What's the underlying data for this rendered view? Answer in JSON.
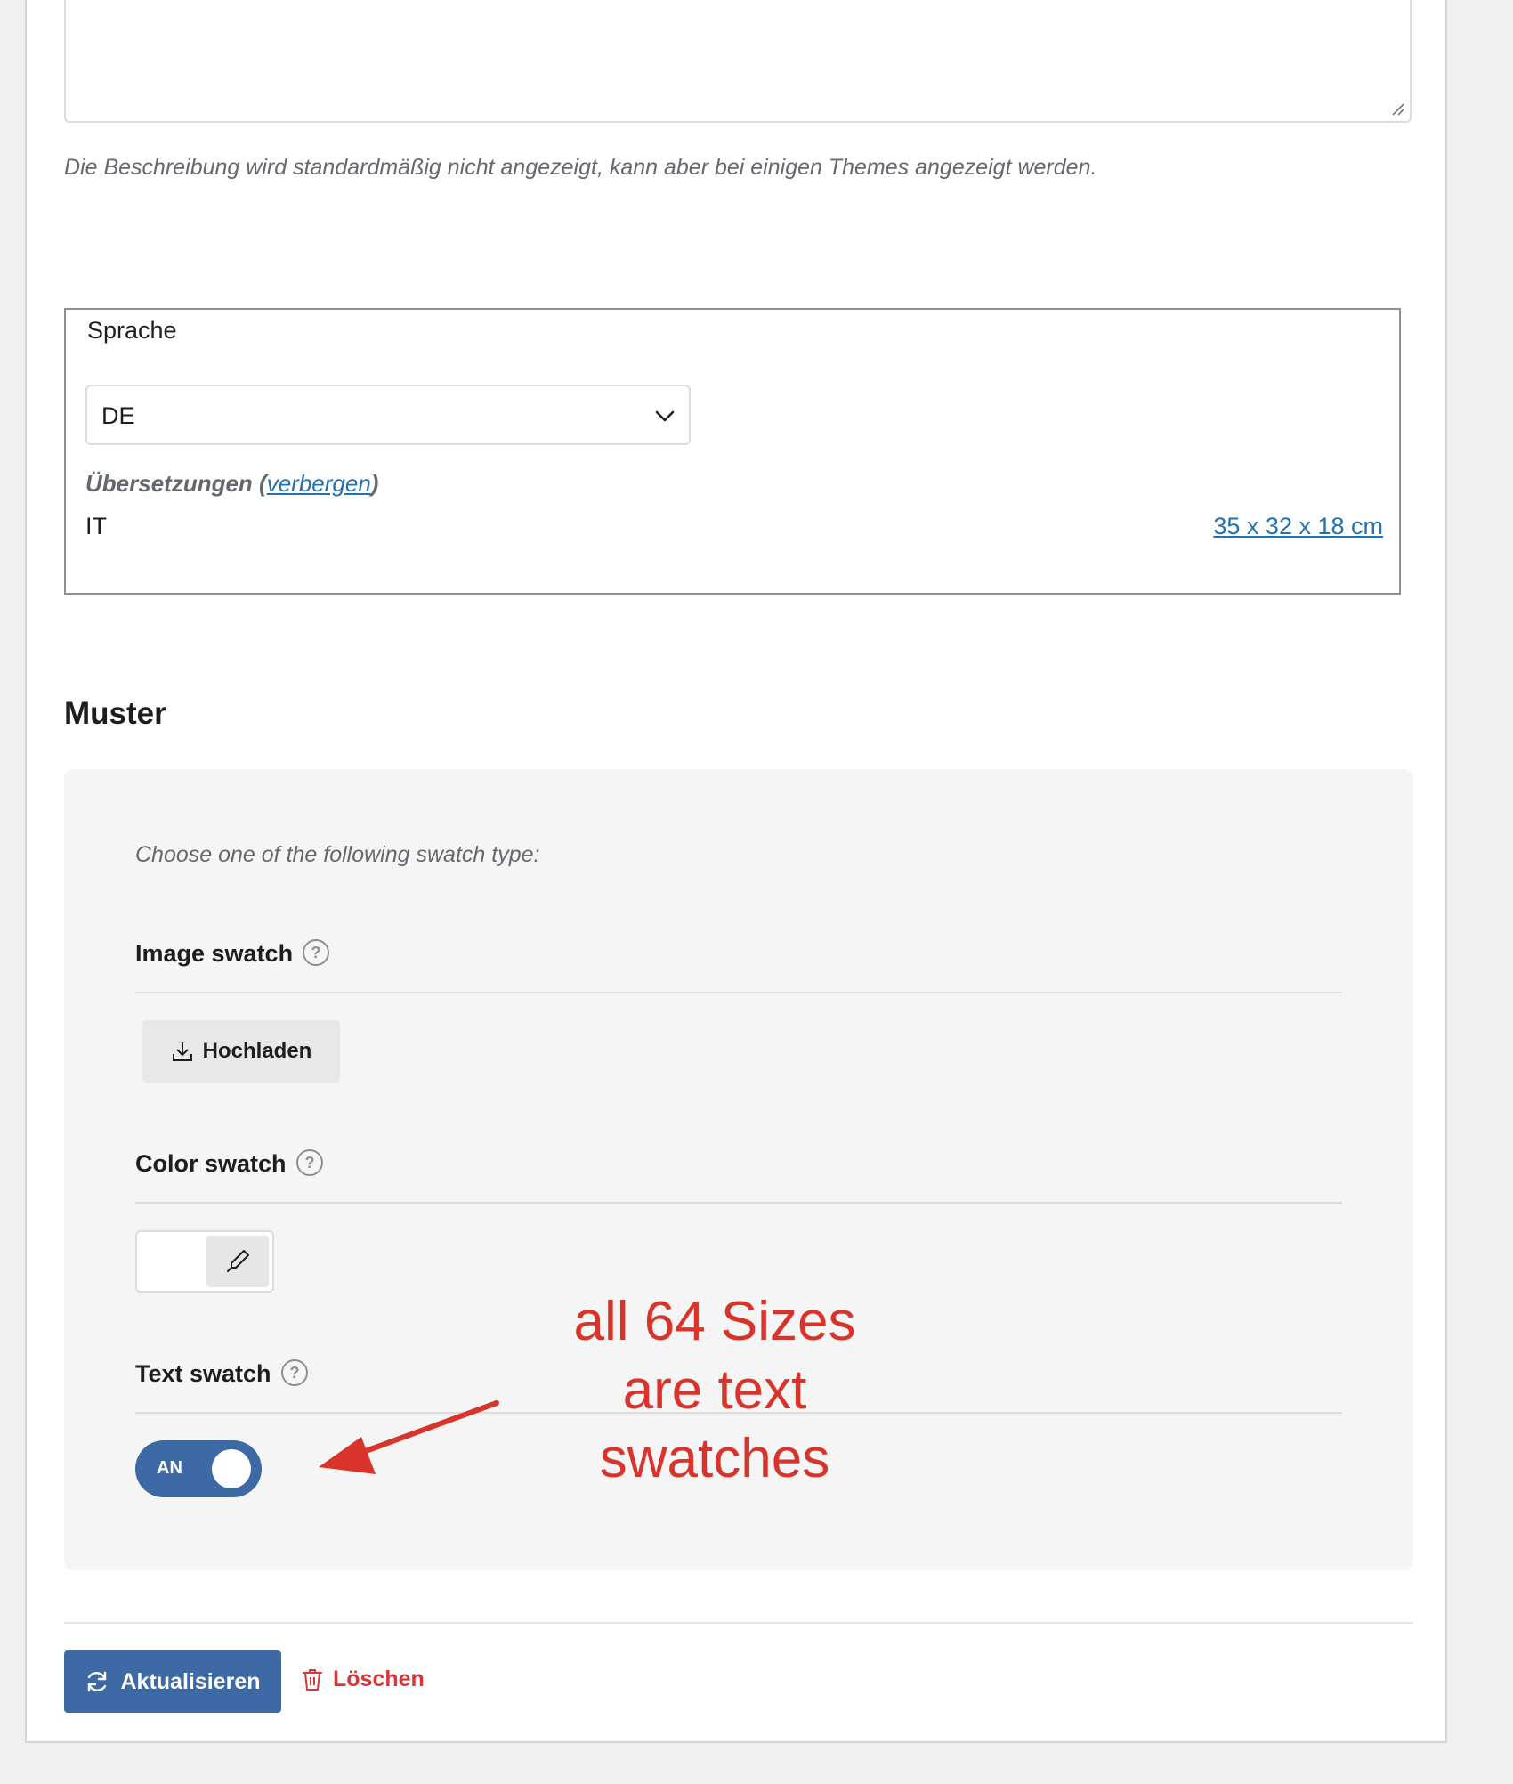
{
  "term_edit": {
    "description_hint": "Die Beschreibung wird standardmäßig nicht angezeigt, kann aber bei einigen Themes angezeigt werden."
  },
  "language": {
    "label": "Sprache",
    "selected": "DE",
    "translations_label": "Übersetzungen",
    "translations_open_paren": " (",
    "translations_toggle": "verbergen",
    "translations_close_paren": ")",
    "translations": [
      {
        "code": "IT",
        "term": "35 x 32 x 18 cm"
      }
    ]
  },
  "swatches": {
    "heading": "Muster",
    "intro": "Choose one of the following swatch type:",
    "image": {
      "title": "Image swatch",
      "upload_label": "Hochladen"
    },
    "color": {
      "title": "Color swatch"
    },
    "text": {
      "title": "Text swatch",
      "toggle_label": "AN",
      "toggle_on": true
    }
  },
  "actions": {
    "update_label": "Aktualisieren",
    "delete_label": "Löschen"
  },
  "annotation": {
    "text": "all 64 Sizes are text swatches"
  },
  "colors": {
    "accent": "#3d6aa5",
    "danger": "#d63638",
    "link": "#2271b1",
    "annotation": "#d9342b"
  },
  "icons": [
    "help-icon",
    "upload-icon",
    "eyedropper-icon",
    "refresh-icon",
    "trash-icon",
    "chevron-down-icon"
  ]
}
